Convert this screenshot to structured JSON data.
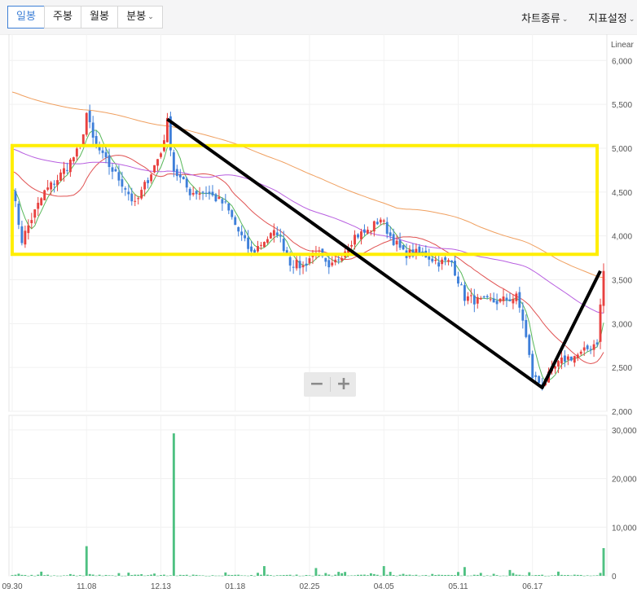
{
  "toolbar": {
    "periods": [
      {
        "label": "일봉",
        "active": true
      },
      {
        "label": "주봉",
        "active": false
      },
      {
        "label": "월봉",
        "active": false
      },
      {
        "label": "분봉",
        "active": false
      }
    ],
    "chart_type_label": "차트종류",
    "indicator_label": "지표설정",
    "chevron_icon": "chevron-down-icon"
  },
  "zoom": {
    "out_label": "−",
    "in_label": "+"
  },
  "colors": {
    "up": "#e8413f",
    "down": "#3e7fd9",
    "volume": "#4fc182",
    "ma_short": "#58b85a",
    "ma_mid": "#e05252",
    "ma_long1": "#b85fe0",
    "ma_long2": "#f0a060",
    "annotation_box": "#ffee00",
    "annotation_line": "#000000"
  },
  "chart_data": {
    "type": "candlestick",
    "scale_label": "Linear",
    "price_ylim": [
      2000,
      6300
    ],
    "price_ticks": [
      "6,000",
      "5,500",
      "5,000",
      "4,500",
      "4,000",
      "3,500",
      "3,000",
      "2,500",
      "2,000"
    ],
    "price_tick_values": [
      6000,
      5500,
      5000,
      4500,
      4000,
      3500,
      3000,
      2500,
      2000
    ],
    "volume_ylim": [
      0,
      33000000
    ],
    "volume_ticks": [
      "30,000,",
      "20,000,",
      "10,000,",
      "0"
    ],
    "volume_tick_values": [
      30000000,
      20000000,
      10000000,
      0
    ],
    "x_ticks": [
      "09.30",
      "11.08",
      "12.13",
      "01.18",
      "02.25",
      "04.05",
      "05.11",
      "06.17"
    ],
    "x_tick_index": [
      0,
      23,
      46,
      69,
      92,
      115,
      138,
      161
    ],
    "n_days": 184,
    "close_anchors": [
      [
        0,
        4550
      ],
      [
        3,
        3950
      ],
      [
        6,
        4200
      ],
      [
        10,
        4500
      ],
      [
        14,
        4650
      ],
      [
        18,
        4850
      ],
      [
        21,
        5000
      ],
      [
        23,
        5400
      ],
      [
        25,
        5100
      ],
      [
        28,
        4900
      ],
      [
        31,
        4750
      ],
      [
        35,
        4550
      ],
      [
        38,
        4350
      ],
      [
        42,
        4650
      ],
      [
        46,
        4950
      ],
      [
        48,
        5300
      ],
      [
        50,
        4750
      ],
      [
        55,
        4500
      ],
      [
        60,
        4500
      ],
      [
        66,
        4350
      ],
      [
        70,
        4050
      ],
      [
        74,
        3800
      ],
      [
        78,
        3950
      ],
      [
        82,
        4050
      ],
      [
        86,
        3700
      ],
      [
        90,
        3650
      ],
      [
        94,
        3850
      ],
      [
        98,
        3600
      ],
      [
        102,
        3800
      ],
      [
        106,
        4000
      ],
      [
        110,
        4050
      ],
      [
        114,
        4200
      ],
      [
        117,
        4000
      ],
      [
        121,
        3800
      ],
      [
        127,
        3800
      ],
      [
        132,
        3700
      ],
      [
        136,
        3700
      ],
      [
        140,
        3300
      ],
      [
        145,
        3250
      ],
      [
        150,
        3250
      ],
      [
        156,
        3300
      ],
      [
        158,
        3050
      ],
      [
        161,
        2400
      ],
      [
        164,
        2300
      ],
      [
        168,
        2500
      ],
      [
        171,
        2600
      ],
      [
        176,
        2650
      ],
      [
        181,
        2800
      ],
      [
        183,
        3600
      ]
    ],
    "volume_spikes": [
      [
        23,
        6100000
      ],
      [
        50,
        29300000
      ],
      [
        78,
        2000000
      ],
      [
        94,
        1600000
      ],
      [
        115,
        2000000
      ],
      [
        140,
        1800000
      ],
      [
        154,
        1200000
      ],
      [
        183,
        5700000
      ]
    ],
    "annotations": {
      "box": {
        "price_top": 5030,
        "price_bottom": 3790,
        "from_index": 2,
        "to_index": 181
      },
      "trend_line": [
        [
          48,
          5330
        ],
        [
          164,
          2270
        ],
        [
          182,
          3600
        ]
      ]
    }
  }
}
